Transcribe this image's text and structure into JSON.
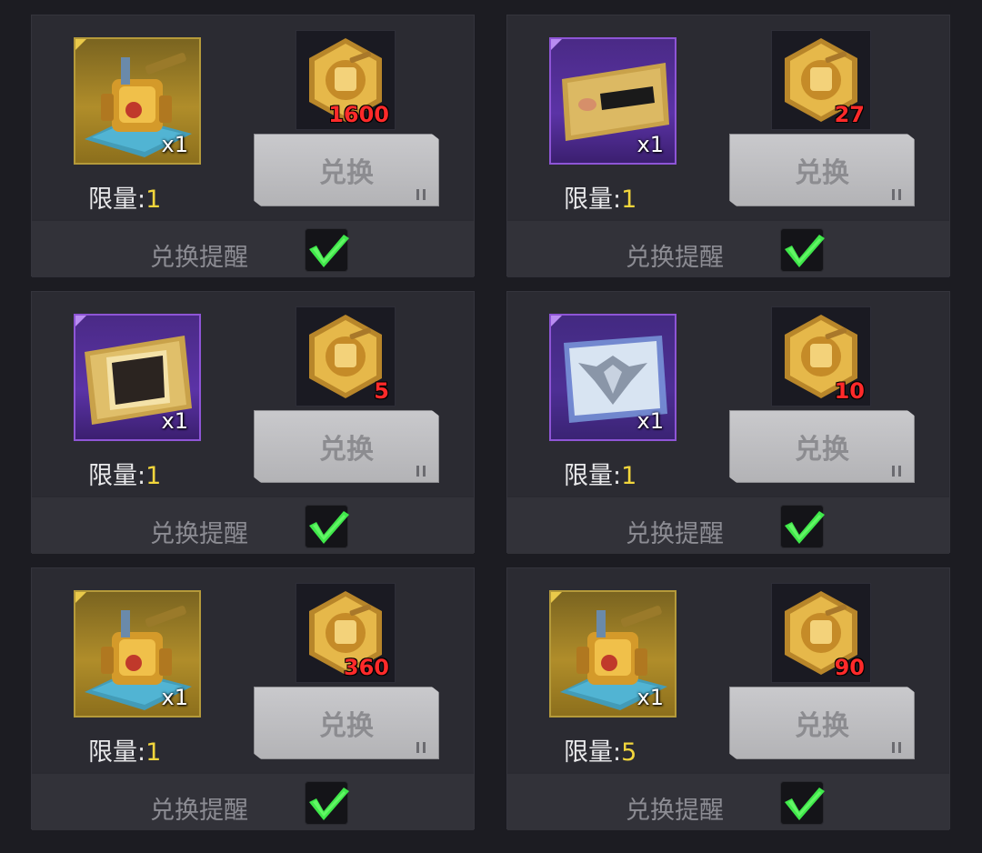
{
  "exchange_label": "兑换",
  "remind_label": "兑换提醒",
  "limit_label": "限量:",
  "items": [
    {
      "item": "battle-mech-icon",
      "frame": "gold",
      "qty": "x1",
      "limit": "1",
      "cost": "1600",
      "remind": true
    },
    {
      "item": "nameplate-card-icon",
      "frame": "purple",
      "qty": "x1",
      "limit": "1",
      "cost": "27",
      "remind": true
    },
    {
      "item": "avatar-frame-card-icon",
      "frame": "purple",
      "qty": "x1",
      "limit": "1",
      "cost": "5",
      "remind": true
    },
    {
      "item": "eagle-badge-icon",
      "frame": "purple",
      "qty": "x1",
      "limit": "1",
      "cost": "10",
      "remind": true
    },
    {
      "item": "battle-mech-icon",
      "frame": "gold",
      "qty": "x1",
      "limit": "1",
      "cost": "360",
      "remind": true
    },
    {
      "item": "battle-mech-icon",
      "frame": "gold",
      "qty": "x1",
      "limit": "5",
      "cost": "90",
      "remind": true
    }
  ],
  "currency_icon": "gold-mech-token-icon",
  "colors": {
    "limit_value": "#f2d63c",
    "cost_value": "#ff2a2a",
    "check": "#3fe84a",
    "gold_frame": "#b59a3a",
    "purple_frame": "#8e55d6"
  }
}
